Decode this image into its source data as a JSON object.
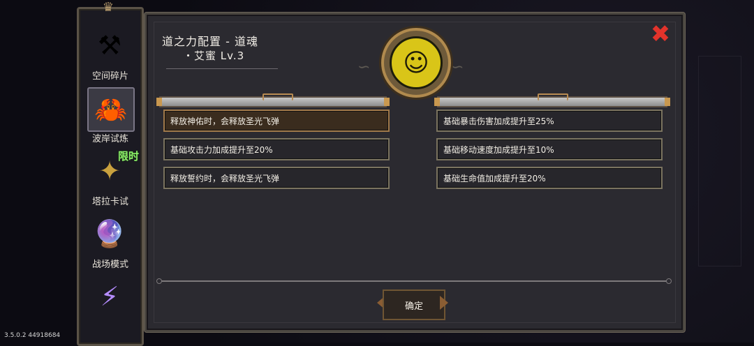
{
  "sidebar": {
    "items": [
      {
        "label": "空间碎片",
        "icon": "space-fragment-icon",
        "glyph": "⚒"
      },
      {
        "label": "波岸试炼",
        "icon": "wave-trial-icon",
        "glyph": "🦀",
        "active": true
      },
      {
        "label": "塔拉卡试",
        "icon": "taraka-trial-icon",
        "glyph": "✦",
        "badge": "限时"
      },
      {
        "label": "战场模式",
        "icon": "battlefield-mode-icon",
        "glyph": "🔮"
      },
      {
        "label": "",
        "icon": "lightning-icon",
        "glyph": "⚡"
      }
    ]
  },
  "panel": {
    "title": "道之力配置 - 道魂",
    "subtitle": "・艾蜜 Lv.3",
    "close_glyph": "✖",
    "medal_glyph": "☺",
    "left_entries": [
      "释放神佑时，会释放圣光飞弹",
      "基础攻击力加成提升至20%",
      "释放誓约时，会释放圣光飞弹"
    ],
    "right_entries": [
      "基础暴击伤害加成提升至25%",
      "基础移动速度加成提升至10%",
      "基础生命值加成提升至20%"
    ],
    "confirm_label": "确定"
  },
  "version": "3.5.0.2 44918684",
  "colors": {
    "accent_gold": "#b08a4e",
    "close_red": "#e2332b",
    "badge_green": "#8df46a"
  }
}
